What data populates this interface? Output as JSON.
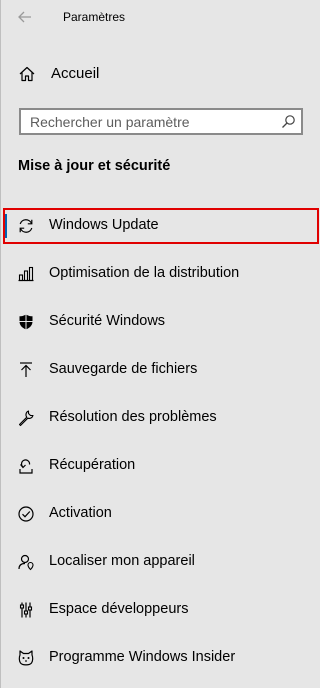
{
  "window": {
    "title": "Paramètres"
  },
  "nav_home": {
    "label": "Accueil",
    "icon": "home-icon"
  },
  "search": {
    "placeholder": "Rechercher un paramètre",
    "value": ""
  },
  "section": {
    "title": "Mise à jour et sécurité"
  },
  "nav_items": [
    {
      "label": "Windows Update",
      "icon": "refresh-icon",
      "selected": true
    },
    {
      "label": "Optimisation de la distribution",
      "icon": "delivery-optimization-icon",
      "selected": false
    },
    {
      "label": "Sécurité Windows",
      "icon": "shield-icon",
      "selected": false
    },
    {
      "label": "Sauvegarde de fichiers",
      "icon": "backup-arrow-icon",
      "selected": false
    },
    {
      "label": "Résolution des problèmes",
      "icon": "wrench-icon",
      "selected": false
    },
    {
      "label": "Récupération",
      "icon": "recovery-icon",
      "selected": false
    },
    {
      "label": "Activation",
      "icon": "check-circle-icon",
      "selected": false
    },
    {
      "label": "Localiser mon appareil",
      "icon": "person-location-icon",
      "selected": false
    },
    {
      "label": "Espace développeurs",
      "icon": "developer-tools-icon",
      "selected": false
    },
    {
      "label": "Programme Windows Insider",
      "icon": "insider-cat-icon",
      "selected": false
    }
  ],
  "colors": {
    "background": "#e6e6e6",
    "accent": "#0063b1",
    "highlight": "#e00000"
  }
}
